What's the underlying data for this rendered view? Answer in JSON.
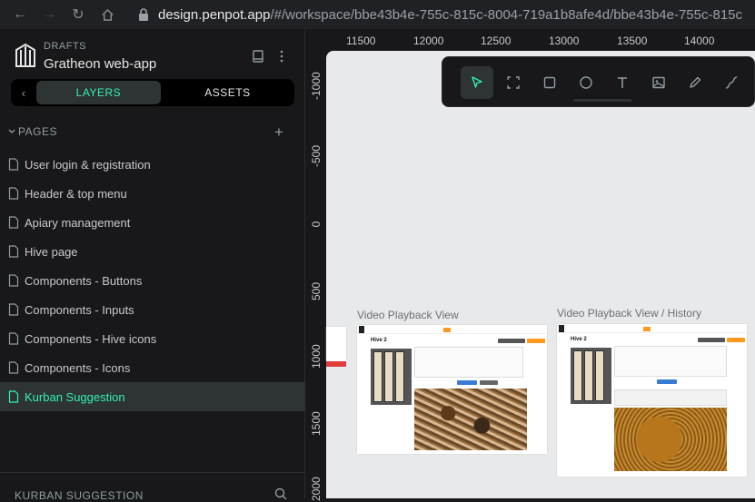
{
  "browser": {
    "url_host": "design.penpot.app",
    "url_path": "/#/workspace/bbe43b4e-755c-815c-8004-719a1b8afe4d/bbe43b4e-755c-815c"
  },
  "header": {
    "section": "DRAFTS",
    "project": "Gratheon web-app"
  },
  "tabs": {
    "layers": "LAYERS",
    "assets": "ASSETS"
  },
  "pages": {
    "title": "PAGES",
    "items": [
      "User login & registration",
      "Header & top menu",
      "Apiary management",
      "Hive page",
      "Components - Buttons",
      "Components - Inputs",
      "Components - Hive icons",
      "Components - Icons",
      "Kurban Suggestion"
    ],
    "selected_index": 8
  },
  "boards_section": "KURBAN SUGGESTION",
  "rulers": {
    "x_ticks": [
      "11500",
      "12000",
      "12500",
      "13000",
      "13500",
      "14000"
    ],
    "y_ticks": [
      "-1000",
      "-500",
      "0",
      "500",
      "1000",
      "1500",
      "2000"
    ]
  },
  "canvas": {
    "boards": [
      {
        "title": "Video Playback View",
        "heading": "Hive 2"
      },
      {
        "title": "Video Playback View / History",
        "heading": "Hive 2"
      }
    ]
  },
  "toolbar": {
    "tools": [
      "pointer-icon",
      "board-icon",
      "rectangle-icon",
      "ellipse-icon",
      "text-icon",
      "image-icon",
      "pen-icon",
      "path-icon"
    ],
    "active_tool": "pointer-icon"
  },
  "colors": {
    "accent": "#31efb8",
    "sidebar_bg": "#18181a",
    "canvas_bg": "#e8e9ea"
  }
}
